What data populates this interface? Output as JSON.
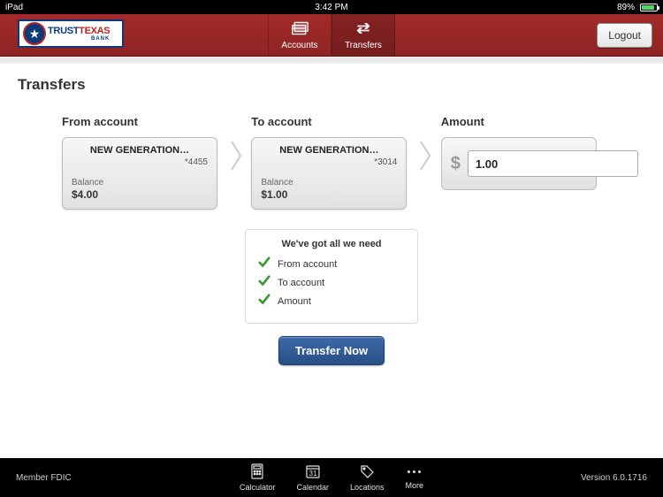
{
  "status": {
    "carrier": "iPad",
    "time": "3:42 PM",
    "battery_pct": "89%"
  },
  "header": {
    "logo": {
      "line1a": "TRUST",
      "line1b": "TEXAS",
      "line2": "BANK"
    },
    "tabs": {
      "accounts": "Accounts",
      "transfers": "Transfers"
    },
    "logout": "Logout"
  },
  "page": {
    "title": "Transfers"
  },
  "transfer": {
    "from": {
      "label": "From account",
      "name": "NEW GENERATION…",
      "acct": "*4455",
      "bal_label": "Balance",
      "bal": "$4.00"
    },
    "to": {
      "label": "To account",
      "name": "NEW GENERATION…",
      "acct": "*3014",
      "bal_label": "Balance",
      "bal": "$1.00"
    },
    "amount": {
      "label": "Amount",
      "prefix": "$",
      "value": "1.00"
    }
  },
  "checklist": {
    "title": "We've got all we need",
    "items": [
      "From account",
      "To account",
      "Amount"
    ]
  },
  "button": {
    "transfer_now": "Transfer Now"
  },
  "footer": {
    "left": "Member FDIC",
    "items": {
      "calculator": "Calculator",
      "calendar": "Calendar",
      "locations": "Locations",
      "more": "More"
    },
    "right": "Version 6.0.1716"
  }
}
